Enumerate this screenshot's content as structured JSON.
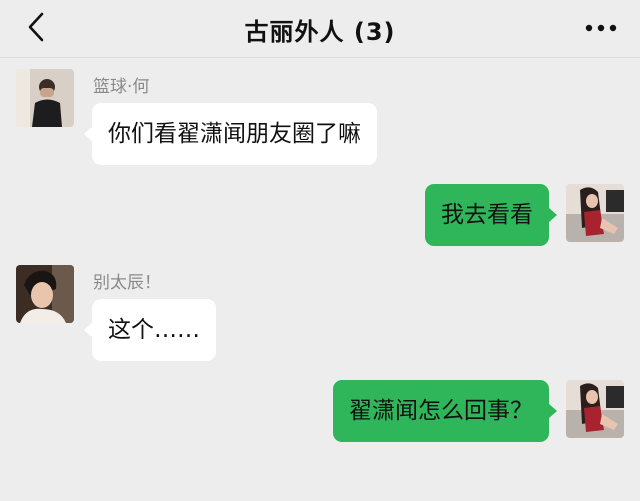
{
  "header": {
    "title": "古丽外人 (3)",
    "back_icon": "chevron-left-icon",
    "more_icon": "more-dots-icon"
  },
  "colors": {
    "background": "#ededed",
    "incoming_bubble": "#ffffff",
    "outgoing_bubble": "#2fb65a"
  },
  "messages": [
    {
      "direction": "in",
      "sender": "篮球·何",
      "text": "你们看翟潇闻朋友圈了嘛"
    },
    {
      "direction": "out",
      "text": "我去看看"
    },
    {
      "direction": "in",
      "sender": "别太辰！",
      "text": "这个……"
    },
    {
      "direction": "out",
      "text": "翟潇闻怎么回事？"
    }
  ]
}
